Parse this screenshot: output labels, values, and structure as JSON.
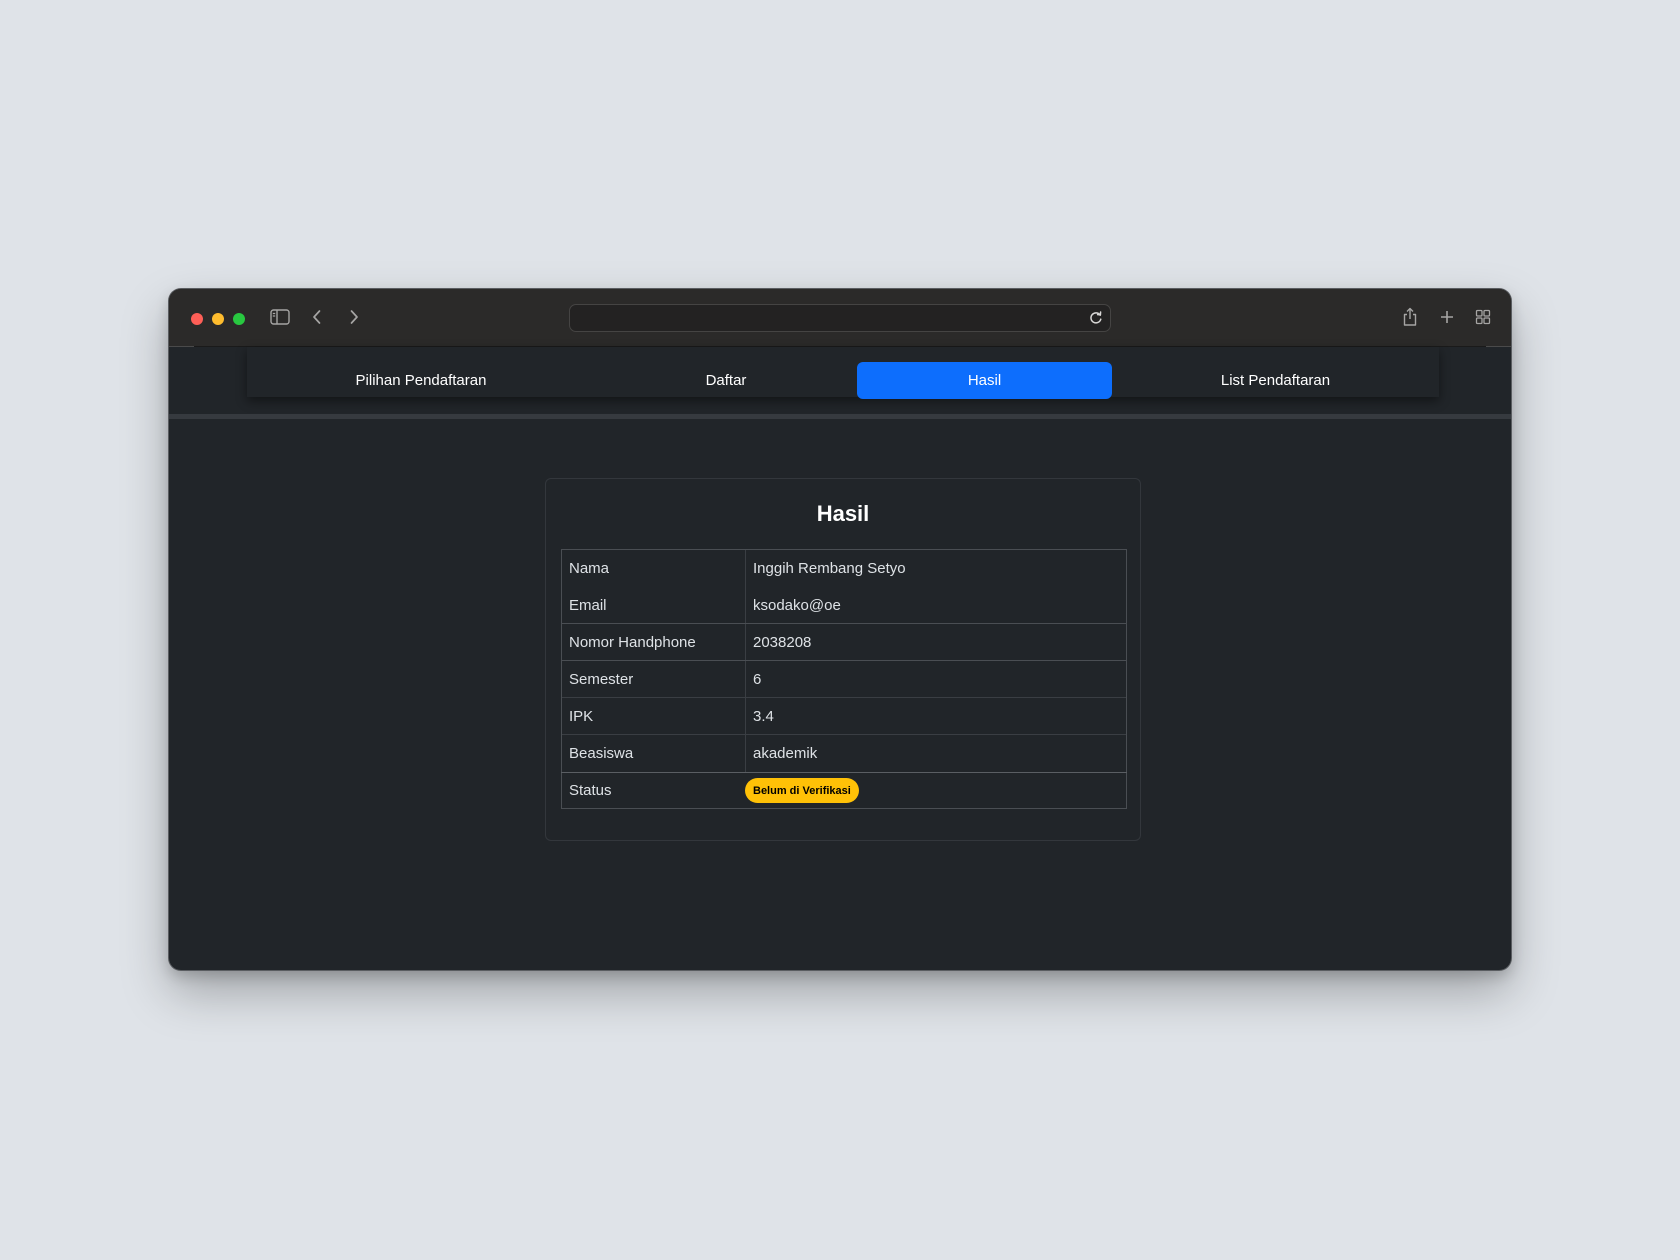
{
  "browser": {
    "url": ""
  },
  "nav": {
    "items": [
      {
        "label": "Pilihan Pendaftaran",
        "active": false
      },
      {
        "label": "Daftar",
        "active": false
      },
      {
        "label": "Hasil",
        "active": true
      },
      {
        "label": "List Pendaftaran",
        "active": false
      }
    ],
    "active_color": "#0d6efd"
  },
  "card": {
    "title": "Hasil"
  },
  "result": {
    "rows": [
      {
        "label": "Nama",
        "value": "Inggih Rembang Setyo"
      },
      {
        "label": "Email",
        "value": "ksodako@oe"
      },
      {
        "label": "Nomor Handphone",
        "value": "2038208"
      },
      {
        "label": "Semester",
        "value": "6"
      },
      {
        "label": "IPK",
        "value": "3.4"
      },
      {
        "label": "Beasiswa",
        "value": "akademik"
      }
    ],
    "status": {
      "label": "Status",
      "badge": "Belum di Verifikasi",
      "badge_color": "#ffc107"
    }
  },
  "theme": {
    "page_bg": "#dfe3e8",
    "window_bg": "#212529"
  }
}
